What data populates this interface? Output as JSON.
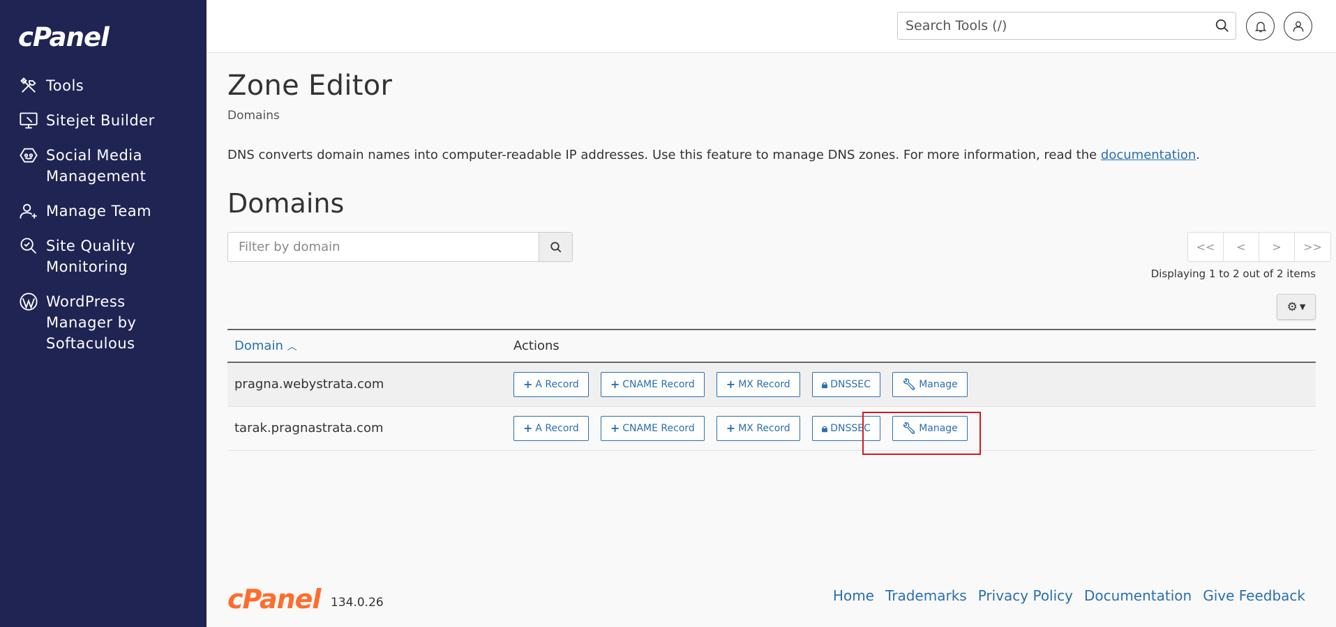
{
  "brand": {
    "logo_text": "cPanel"
  },
  "sidebar": {
    "items": [
      {
        "label": "Tools",
        "icon": "tools-icon"
      },
      {
        "label": "Sitejet Builder",
        "icon": "monitor-icon"
      },
      {
        "label": "Social Media Management",
        "icon": "social-icon"
      },
      {
        "label": "Manage Team",
        "icon": "team-icon"
      },
      {
        "label": "Site Quality Monitoring",
        "icon": "quality-icon"
      },
      {
        "label": "WordPress Manager by Softaculous",
        "icon": "wordpress-icon"
      }
    ]
  },
  "header": {
    "search_placeholder": "Search Tools (/)"
  },
  "page": {
    "title": "Zone Editor",
    "breadcrumb": "Domains",
    "description_prefix": "DNS converts domain names into computer-readable IP addresses. Use this feature to manage DNS zones. For more information, read the ",
    "description_link": "documentation",
    "description_suffix": ".",
    "section_title": "Domains",
    "filter_placeholder": "Filter by domain",
    "pager": {
      "first": "<<",
      "prev": "<",
      "next": ">",
      "last": ">>"
    },
    "display_count": "Displaying 1 to 2 out of 2 items"
  },
  "table": {
    "headers": {
      "domain": "Domain",
      "actions": "Actions"
    },
    "action_labels": {
      "a_record": "A Record",
      "cname_record": "CNAME Record",
      "mx_record": "MX Record",
      "dnssec": "DNSSEC",
      "manage": "Manage"
    },
    "rows": [
      {
        "domain": "pragna.webystrata.com"
      },
      {
        "domain": "tarak.pragnastrata.com"
      }
    ]
  },
  "footer": {
    "logo_text": "cPanel",
    "version": "134.0.26",
    "links": [
      "Home",
      "Trademarks",
      "Privacy Policy",
      "Documentation",
      "Give Feedback"
    ]
  },
  "colors": {
    "sidebar_bg": "#1f2453",
    "link": "#2a6fb0",
    "brand_orange": "#ff6c2c",
    "highlight": "#d0191f"
  }
}
